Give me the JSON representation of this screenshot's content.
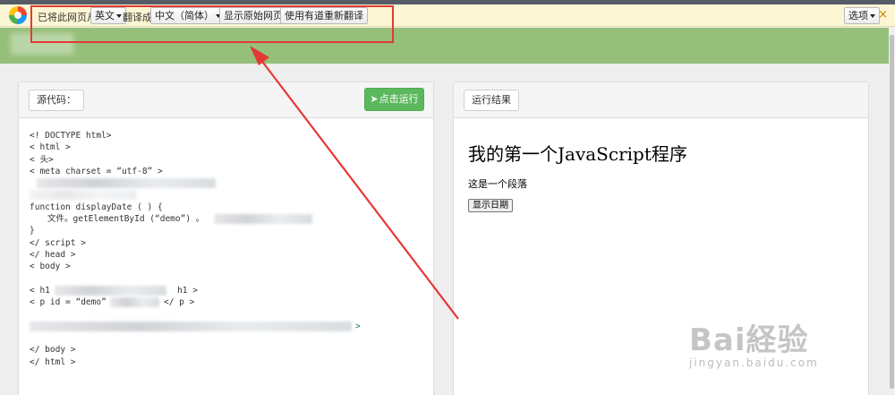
{
  "translate_bar": {
    "prefix": "已将此网页从",
    "from_lang": "英文",
    "translated_to": "翻译成",
    "to_lang": "中文（简体）",
    "show_original": "显示原始网页",
    "retranslate": "使用有道重新翻译",
    "options": "选项",
    "close": "×"
  },
  "left_panel": {
    "source_label": "源代码：",
    "run_label": "点击运行",
    "code_lines": [
      "<! DOCTYPE html>",
      "< html >",
      "< 头>",
      "< meta charset = “utf-8” >",
      "",
      "",
      "function displayDate ( ) {",
      "文件。getElementById (“demo”) 。",
      "}",
      "</ script >",
      "</ head >",
      "< body >",
      "",
      "< h1",
      "< p id = “demo”",
      "",
      "",
      "</ body >",
      "</ html >"
    ]
  },
  "right_panel": {
    "result_label": "运行结果",
    "heading": "我的第一个JavaScript程序",
    "paragraph": "这是一个段落",
    "button": "显示日期"
  },
  "watermark": {
    "brand": "Bai経验",
    "url": "jingyan.baidu.com"
  },
  "colors": {
    "translate_bar_bg": "#fdf6d4",
    "header_green": "#96c07a",
    "run_button_green": "#5cb85c",
    "annotation_red": "#e53935"
  }
}
